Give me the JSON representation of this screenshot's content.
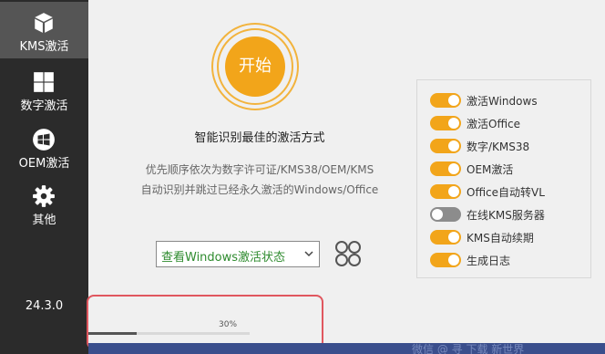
{
  "sidebar": {
    "items": [
      {
        "label": "KMS激活",
        "icon": "box-icon",
        "active": true
      },
      {
        "label": "数字激活",
        "icon": "windows-icon",
        "active": false
      },
      {
        "label": "OEM激活",
        "icon": "windows-flag-icon",
        "active": false
      },
      {
        "label": "其他",
        "icon": "gear-icon",
        "active": false
      }
    ],
    "version": "24.3.0"
  },
  "main": {
    "start_label": "开始",
    "headline": "智能识别最佳的激活方式",
    "description_line1": "优先顺序依次为数字许可证/KMS38/OEM/KMS",
    "description_line2": "自动识别并跳过已经永久激活的Windows/Office",
    "status_select": {
      "value": "查看Windows激活状态"
    },
    "clover_icon": "clover-icon"
  },
  "options": [
    {
      "label": "激活Windows",
      "checked": true
    },
    {
      "label": "激活Office",
      "checked": true
    },
    {
      "label": "数字/KMS38",
      "checked": true
    },
    {
      "label": "OEM激活",
      "checked": true
    },
    {
      "label": "Office自动转VL",
      "checked": true
    },
    {
      "label": "在线KMS服务器",
      "checked": false
    },
    {
      "label": "KMS自动续期",
      "checked": true
    },
    {
      "label": "生成日志",
      "checked": true
    }
  ],
  "progress": {
    "text": "30%",
    "value": 0.3
  },
  "colors": {
    "accent": "#f2a51a",
    "sidebar": "#2b2b2b",
    "sidebar_active": "#555555",
    "highlight": "#e0575f",
    "select_text": "#2e8b2e"
  },
  "taskbar": {
    "text": "微信 @ 寻 下载 新世界"
  }
}
